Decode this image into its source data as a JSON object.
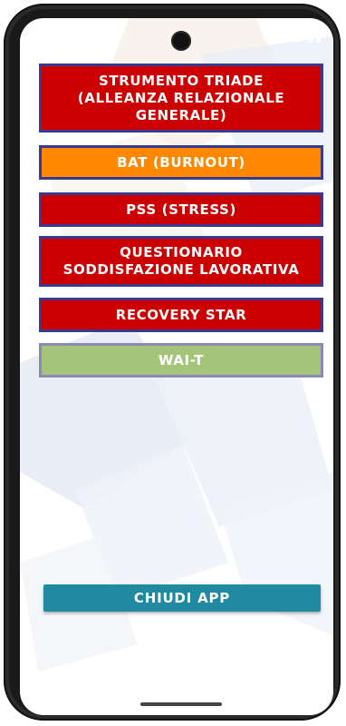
{
  "colors": {
    "red": "#cc0000",
    "orange": "#ff8800",
    "green": "#a4c47a",
    "border_blue": "#3a3a8c",
    "teal": "#1f8aa0"
  },
  "status_bar": {
    "icons": [
      "wifi-icon",
      "signal-icon",
      "battery-icon"
    ]
  },
  "menu": {
    "items": [
      {
        "label": "STRUMENTO TRIADE\n(ALLEANZA RELAZIONALE\nGENERALE)"
      },
      {
        "label": "BAT (BURNOUT)"
      },
      {
        "label": "PSS (STRESS)"
      },
      {
        "label": "QUESTIONARIO\nSODDISFAZIONE LAVORATIVA"
      },
      {
        "label": "RECOVERY STAR"
      },
      {
        "label": "WAI-T"
      }
    ]
  },
  "footer": {
    "close_label": "CHIUDI APP"
  }
}
